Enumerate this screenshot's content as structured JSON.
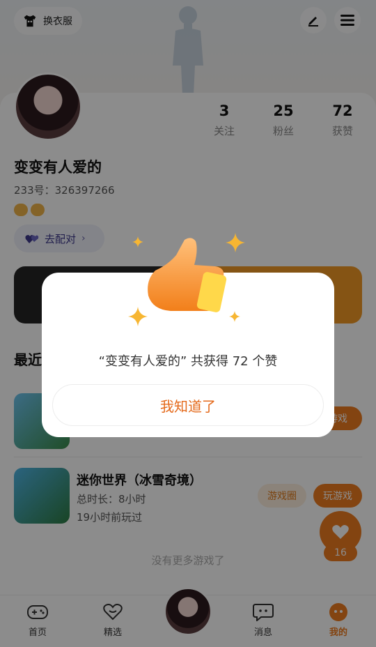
{
  "header": {
    "dress_button_label": "换衣服"
  },
  "profile": {
    "nickname": "变变有人爱的",
    "id_text": "233号：326397266",
    "pair_button_label": "去配对",
    "stats": [
      {
        "value": "3",
        "label": "关注"
      },
      {
        "value": "25",
        "label": "粉丝"
      },
      {
        "value": "72",
        "label": "获赞"
      }
    ]
  },
  "section": {
    "recent_title": "最近"
  },
  "games": [
    {
      "title": "",
      "duration": "",
      "last_played": "",
      "action_label": "游戏"
    },
    {
      "title": "迷你世界（冰雪奇境）",
      "duration": "总时长：8小时",
      "last_played": "19小时前玩过",
      "circle_label": "游戏圈",
      "action_label": "玩游戏"
    }
  ],
  "footer_note": "没有更多游戏了",
  "like_fab": {
    "count": "16"
  },
  "tabs": [
    {
      "label": "首页",
      "icon": "gamepad-icon"
    },
    {
      "label": "精选",
      "icon": "heart-outline-icon"
    },
    {
      "label": "消息",
      "icon": "chat-icon"
    },
    {
      "label": "我的",
      "icon": "profile-face-icon",
      "active": true
    }
  ],
  "dialog": {
    "message": "“变变有人爱的” 共获得 72 个赞",
    "confirm_label": "我知道了"
  },
  "colors": {
    "accent": "#ef7c1f",
    "dialog_button_text": "#e4691a"
  }
}
